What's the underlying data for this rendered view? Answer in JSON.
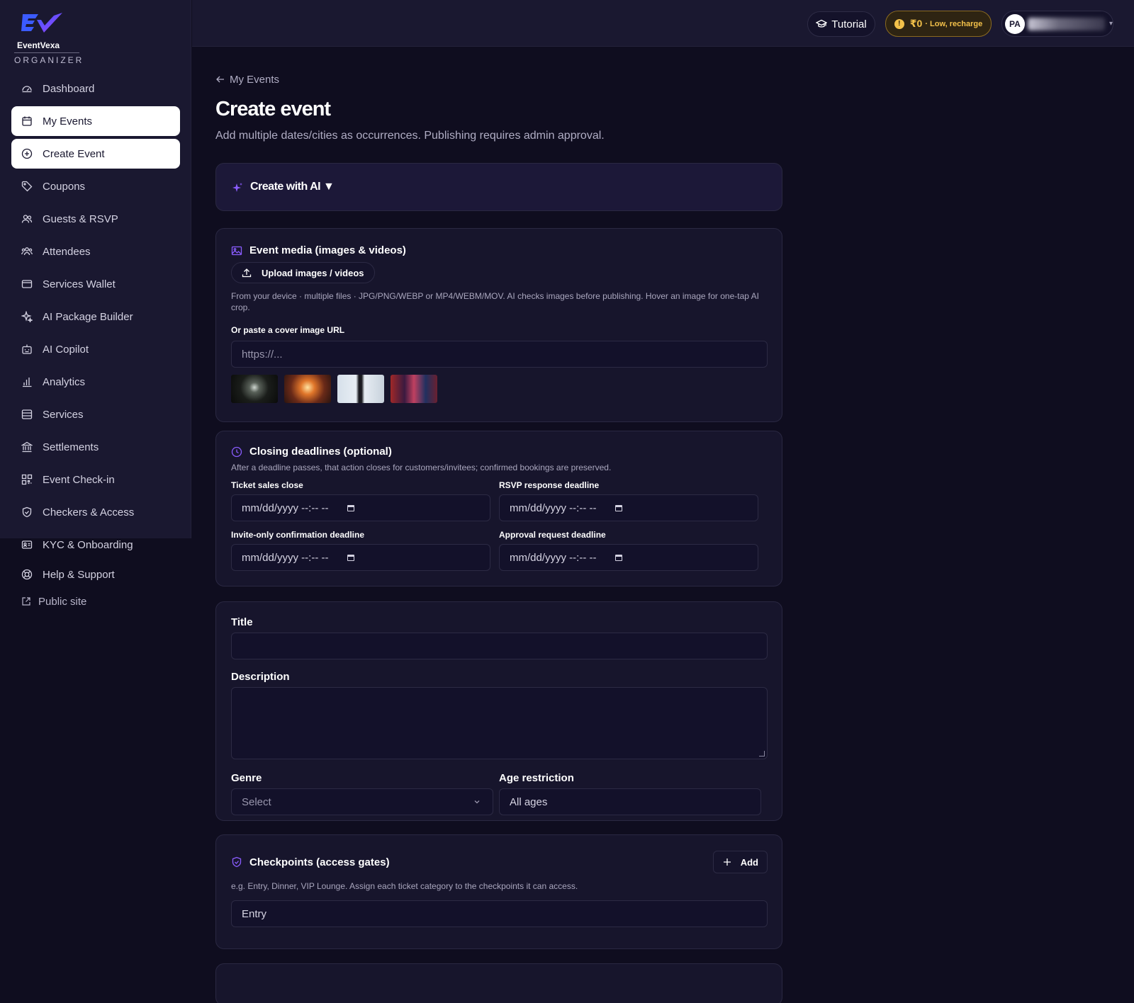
{
  "brand": {
    "name": "EventVexa",
    "subtitle": "ORGANIZER",
    "colors": {
      "accent": "#7c5cff",
      "brand_blue": "#3b5bff",
      "wallet_yellow": "#f3c14a"
    }
  },
  "sidebar": {
    "items": [
      {
        "label": "Dashboard",
        "icon": "dashboard-icon"
      },
      {
        "label": "My Events",
        "icon": "calendar-icon",
        "active": true
      },
      {
        "label": "Create Event",
        "icon": "plus-circle-icon",
        "active": true
      },
      {
        "label": "Coupons",
        "icon": "tag-icon"
      },
      {
        "label": "Guests & RSVP",
        "icon": "users-icon"
      },
      {
        "label": "Attendees",
        "icon": "attendees-icon"
      },
      {
        "label": "Services Wallet",
        "icon": "wallet-icon"
      },
      {
        "label": "AI Package Builder",
        "icon": "sparkle-icon"
      },
      {
        "label": "AI Copilot",
        "icon": "bot-icon"
      },
      {
        "label": "Analytics",
        "icon": "bar-chart-icon"
      },
      {
        "label": "Services",
        "icon": "store-icon"
      },
      {
        "label": "Settlements",
        "icon": "bank-icon"
      },
      {
        "label": "Event Check-in",
        "icon": "qr-icon"
      },
      {
        "label": "Checkers & Access",
        "icon": "shield-icon"
      },
      {
        "label": "KYC & Onboarding",
        "icon": "id-card-icon"
      }
    ],
    "help": "Help & Support",
    "public_site": "Public site"
  },
  "topbar": {
    "tutorial": "Tutorial",
    "wallet_amount": "₹0",
    "wallet_note": "· Low, recharge",
    "avatar_initials": "PA"
  },
  "page": {
    "back_label": "My Events",
    "title": "Create event",
    "subtitle": "Add multiple dates/cities as occurrences. Publishing requires admin approval.",
    "ai_label": "Create with AI ▼"
  },
  "media": {
    "heading": "Event media (images & videos)",
    "upload_label": "Upload images / videos",
    "hint": "From your device · multiple files · JPG/PNG/WEBP or MP4/WEBM/MOV. AI checks images before publishing. Hover an image for one-tap AI crop.",
    "url_label": "Or paste a cover image URL",
    "url_placeholder": "https://..."
  },
  "deadlines": {
    "heading": "Closing deadlines (optional)",
    "hint": "After a deadline passes, that action closes for customers/invitees; confirmed bookings are preserved.",
    "fields": [
      {
        "label": "Ticket sales close",
        "placeholder": "mm/dd/yyyy --:-- --"
      },
      {
        "label": "RSVP response deadline",
        "placeholder": "mm/dd/yyyy --:-- --"
      },
      {
        "label": "Invite-only confirmation deadline",
        "placeholder": "mm/dd/yyyy --:-- --"
      },
      {
        "label": "Approval request deadline",
        "placeholder": "mm/dd/yyyy --:-- --"
      }
    ]
  },
  "details": {
    "title_label": "Title",
    "title_value": "",
    "description_label": "Description",
    "description_value": "",
    "genre_label": "Genre",
    "genre_value": "Select",
    "age_label": "Age restriction",
    "age_value": "All ages"
  },
  "checkpoints": {
    "heading": "Checkpoints (access gates)",
    "add_label": "Add",
    "hint": "e.g. Entry, Dinner, VIP Lounge. Assign each ticket category to the checkpoints it can access.",
    "value": "Entry"
  }
}
